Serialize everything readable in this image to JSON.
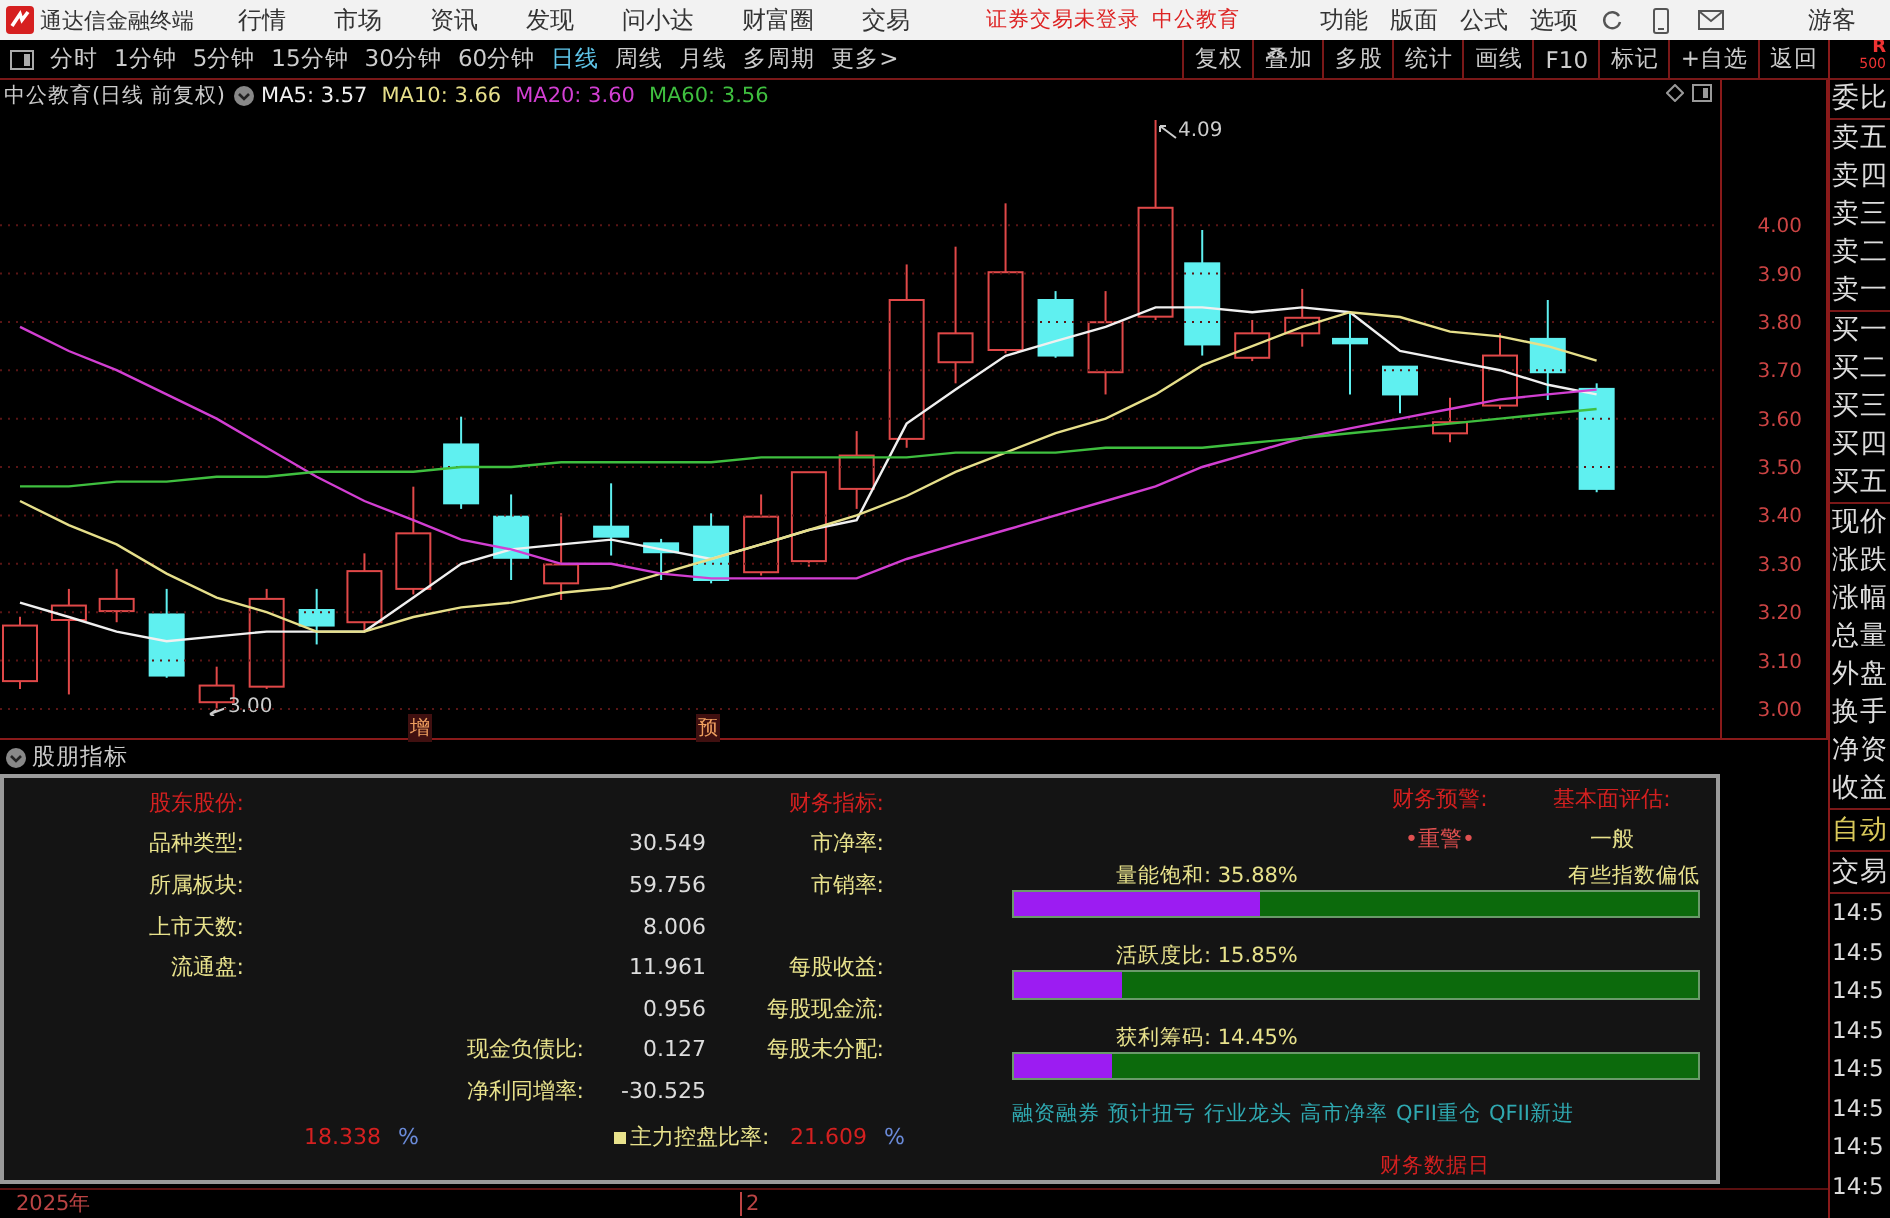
{
  "window": {
    "app_name": "通达信金融终端"
  },
  "menu": [
    "行情",
    "市场",
    "资讯",
    "发现",
    "问小达",
    "财富圈",
    "交易"
  ],
  "login_status": "证券交易未登录",
  "account_name": "中公教育",
  "tools": [
    "功能",
    "版面",
    "公式",
    "选项"
  ],
  "user": "游客",
  "periods": [
    {
      "label": "分时",
      "selected": false
    },
    {
      "label": "1分钟",
      "selected": false
    },
    {
      "label": "5分钟",
      "selected": false
    },
    {
      "label": "15分钟",
      "selected": false
    },
    {
      "label": "30分钟",
      "selected": false
    },
    {
      "label": "60分钟",
      "selected": false
    },
    {
      "label": "日线",
      "selected": true
    },
    {
      "label": "周线",
      "selected": false
    },
    {
      "label": "月线",
      "selected": false
    },
    {
      "label": "多周期",
      "selected": false
    },
    {
      "label": "更多>",
      "selected": false
    }
  ],
  "toolbar_buttons": [
    "复权",
    "叠加",
    "多股",
    "统计",
    "画线",
    "F10",
    "标记",
    "+自选",
    "返回"
  ],
  "quote_badge": {
    "letter": "R",
    "value": "500"
  },
  "chart": {
    "title": "中公教育(日线 前复权)",
    "moving_averages": [
      {
        "label": "MA5: 3.57"
      },
      {
        "label": "MA10: 3.66"
      },
      {
        "label": "MA20: 3.60"
      },
      {
        "label": "MA60: 3.56"
      }
    ],
    "high_label": "4.09",
    "low_label": "3.00",
    "event_markers": [
      "增",
      "预"
    ],
    "chart_data": {
      "type": "line",
      "ylim": [
        2.94,
        4.3
      ],
      "grid": true,
      "yticks": [
        {
          "value": 4.0,
          "label": "4.00"
        },
        {
          "value": 3.9,
          "label": "3.90"
        },
        {
          "value": 3.8,
          "label": "3.80"
        },
        {
          "value": 3.7,
          "label": "3.70"
        },
        {
          "value": 3.6,
          "label": "3.60"
        },
        {
          "value": 3.5,
          "label": "3.50"
        },
        {
          "value": 3.4,
          "label": "3.40"
        },
        {
          "value": 3.3,
          "label": "3.30"
        },
        {
          "value": 3.2,
          "label": "3.20"
        },
        {
          "value": 3.1,
          "label": "3.10"
        },
        {
          "value": 3.0,
          "label": "3.00"
        }
      ],
      "series": [
        {
          "color": "#f0f0f0",
          "values": [
            3.22,
            3.19,
            3.16,
            3.14,
            3.15,
            3.16,
            3.16,
            3.16,
            3.23,
            3.3,
            3.33,
            3.34,
            3.35,
            3.33,
            3.31,
            3.34,
            3.37,
            3.39,
            3.59,
            3.66,
            3.73,
            3.76,
            3.79,
            3.83,
            3.83,
            3.82,
            3.83,
            3.82,
            3.74,
            3.72,
            3.7,
            3.67,
            3.65
          ]
        },
        {
          "color": "#e6df8a",
          "values": [
            3.43,
            3.38,
            3.34,
            3.28,
            3.23,
            3.2,
            3.16,
            3.16,
            3.19,
            3.21,
            3.22,
            3.24,
            3.25,
            3.28,
            3.31,
            3.34,
            3.37,
            3.4,
            3.44,
            3.49,
            3.53,
            3.57,
            3.6,
            3.65,
            3.71,
            3.75,
            3.79,
            3.82,
            3.81,
            3.78,
            3.77,
            3.75,
            3.72
          ]
        },
        {
          "color": "#d23fd2",
          "values": [
            3.79,
            3.74,
            3.7,
            3.65,
            3.6,
            3.54,
            3.48,
            3.43,
            3.39,
            3.35,
            3.33,
            3.3,
            3.3,
            3.28,
            3.27,
            3.27,
            3.27,
            3.27,
            3.31,
            3.34,
            3.37,
            3.4,
            3.43,
            3.46,
            3.5,
            3.53,
            3.56,
            3.58,
            3.6,
            3.62,
            3.64,
            3.65,
            3.66
          ]
        },
        {
          "color": "#3fbf3f",
          "values": [
            3.46,
            3.46,
            3.47,
            3.47,
            3.48,
            3.48,
            3.49,
            3.49,
            3.49,
            3.5,
            3.5,
            3.51,
            3.51,
            3.51,
            3.51,
            3.52,
            3.52,
            3.52,
            3.52,
            3.53,
            3.53,
            3.53,
            3.54,
            3.54,
            3.54,
            3.55,
            3.56,
            3.57,
            3.58,
            3.59,
            3.6,
            3.61,
            3.62
          ]
        }
      ]
    }
  },
  "quote_panel": {
    "groups": [
      [
        "委比"
      ],
      [
        "卖五",
        "卖四",
        "卖三",
        "卖二",
        "卖一"
      ],
      [
        "买一",
        "买二",
        "买三",
        "买四",
        "买五"
      ],
      [
        "现价",
        "涨跌",
        "涨幅",
        "总量",
        "外盘",
        "换手",
        "净资",
        "收益"
      ]
    ],
    "mode": "自动",
    "section": "交易",
    "times": [
      "14:5",
      "14:5",
      "14:5",
      "14:5",
      "14:5",
      "14:5",
      "14:5",
      "14:5"
    ]
  },
  "indicator": {
    "title": "股朋指标",
    "left_heading": "股东股份:",
    "right_heading": "财务指标:",
    "rows": [
      {
        "label": "品种类型:",
        "value": "30.549",
        "metric": "市净率:"
      },
      {
        "label": "所属板块:",
        "value": "59.756",
        "metric": "市销率:"
      },
      {
        "label": "上市天数:",
        "value": "8.006"
      },
      {
        "label": "流通盘:",
        "value": "11.961",
        "metric": "每股收益:"
      },
      {
        "value": "0.956",
        "metric": "每股现金流:"
      },
      {
        "sub_label": "现金负债比:",
        "value": "0.127",
        "metric": "每股未分配:"
      },
      {
        "sub_label": "净利同增率:",
        "value": "-30.525"
      }
    ],
    "holding_value": "18.338",
    "holding_unit": "%",
    "control_label": "主力控盘比率:",
    "control_value": "21.609",
    "control_unit": "%",
    "warning_heading": "财务预警:",
    "warning": "•重警•",
    "evaluation_heading": "基本面评估:",
    "rating": "一般",
    "comment": "有些指数偏低",
    "bars": [
      {
        "label": "量能饱和: 35.88%",
        "level": 0.3588
      },
      {
        "label": "活跃度比: 15.85%",
        "level": 0.1585
      },
      {
        "label": "获利筹码: 14.45%",
        "level": 0.1445
      }
    ],
    "tags": [
      "融资融券",
      "预计扭亏",
      "行业龙头",
      "高市净率",
      "QFII重仓",
      "QFII新进"
    ],
    "data_date": "财务数据日"
  },
  "status_bar": {
    "year": "2025年",
    "page": "2"
  }
}
